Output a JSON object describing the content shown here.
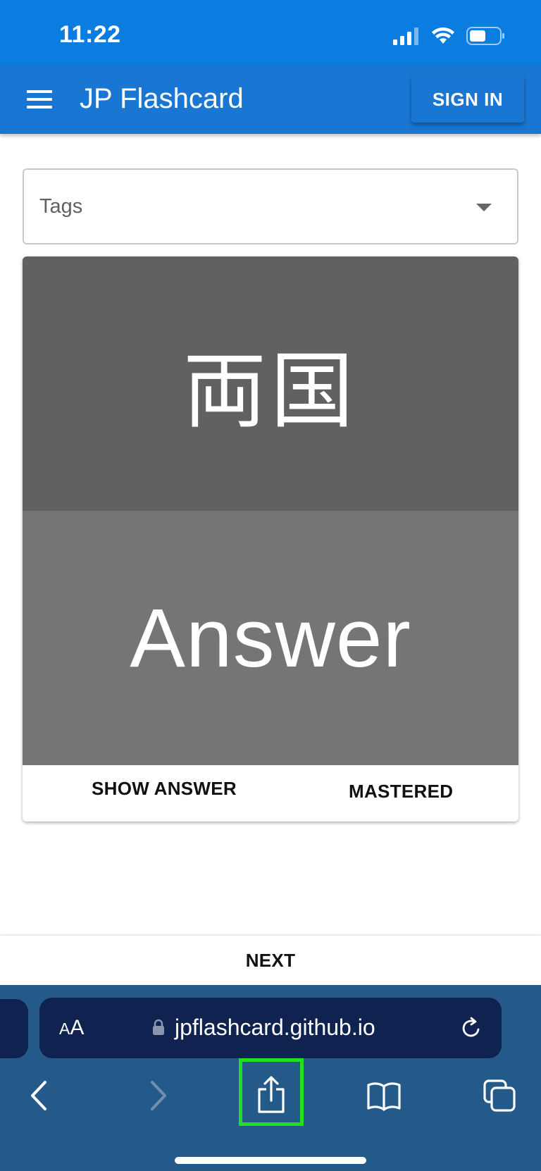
{
  "status_bar": {
    "time": "11:22",
    "icons": [
      "cellular-signal-icon",
      "wifi-icon",
      "battery-icon"
    ]
  },
  "app_bar": {
    "title": "JP Flashcard",
    "sign_in_label": "SIGN IN",
    "menu_icon": "hamburger-menu-icon",
    "color": "#1976d2"
  },
  "tags_select": {
    "placeholder": "Tags",
    "icon": "dropdown-arrow-icon"
  },
  "card": {
    "front_text": "両国",
    "back_text": "Answer",
    "front_color": "#616161",
    "back_color": "#757575",
    "actions": {
      "show_answer_label": "SHOW ANSWER",
      "mastered_label": "MASTERED"
    }
  },
  "next": {
    "label": "NEXT"
  },
  "browser": {
    "text_size_label": "AA",
    "url": "jpflashcard.github.io",
    "toolbar_icons": [
      "back-icon",
      "forward-icon",
      "share-icon",
      "bookmarks-icon",
      "tabs-icon"
    ],
    "highlight_color": "#22e01e"
  }
}
